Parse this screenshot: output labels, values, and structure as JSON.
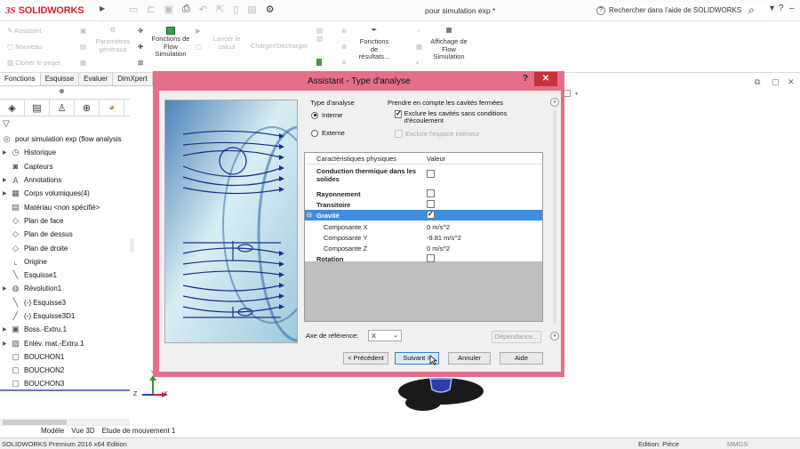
{
  "app": {
    "logo_ds": "3S",
    "logo_name": "SOLIDWORKS",
    "document_title": "pour simulation exp *",
    "help_search": "Rechercher dans l'aide de SOLIDWORKS"
  },
  "ribbon": {
    "left_small": [
      "Assistant",
      "Nouveau",
      "Cloner le projet"
    ],
    "parametres": "Paramètres généraux",
    "fonctions_flow": "Fonctions de Flow Simulation",
    "lancer": "Lancer le calcul",
    "charger": "Charger/Décharger",
    "fonctions_resultats": "Fonctions de résultats...",
    "affichage": "Affichage de Flow Simulation"
  },
  "panel_tabs": [
    "Fonctions",
    "Esquisse",
    "Evaluer",
    "DimXpert"
  ],
  "tree": {
    "root": "pour simulation exp  (flow analysis",
    "items": [
      {
        "label": "Historique",
        "expand": true,
        "icon": "history-icon"
      },
      {
        "label": "Capteurs",
        "expand": false,
        "icon": "sensor-icon"
      },
      {
        "label": "Annotations",
        "expand": true,
        "icon": "annotation-icon"
      },
      {
        "label": "Corps volumiques(4)",
        "expand": true,
        "icon": "solid-bodies-icon"
      },
      {
        "label": "Matériau <non spécifié>",
        "expand": false,
        "icon": "material-icon"
      },
      {
        "label": "Plan de face",
        "expand": false,
        "icon": "plane-icon"
      },
      {
        "label": "Plan de dessus",
        "expand": false,
        "icon": "plane-icon"
      },
      {
        "label": "Plan de droite",
        "expand": false,
        "icon": "plane-icon"
      },
      {
        "label": "Origine",
        "expand": false,
        "icon": "origin-icon"
      },
      {
        "label": "Esquisse1",
        "expand": false,
        "icon": "sketch-icon"
      },
      {
        "label": "Révolution1",
        "expand": true,
        "icon": "revolve-icon"
      },
      {
        "label": "(-) Esquisse3",
        "expand": false,
        "icon": "sketch-icon"
      },
      {
        "label": "(-) Esquisse3D1",
        "expand": false,
        "icon": "sketch3d-icon"
      },
      {
        "label": "Boss.-Extru.1",
        "expand": true,
        "icon": "extrude-icon"
      },
      {
        "label": "Enlév. mat.-Extru.1",
        "expand": true,
        "icon": "cut-icon"
      },
      {
        "label": "BOUCHON1",
        "expand": false,
        "icon": "lid-icon"
      },
      {
        "label": "BOUCHON2",
        "expand": false,
        "icon": "lid-icon"
      },
      {
        "label": "BOUCHON3",
        "expand": false,
        "icon": "lid-icon"
      }
    ]
  },
  "bottom_tabs": [
    "Modèle",
    "Vue 3D",
    "Etude de mouvement 1"
  ],
  "status": {
    "left": "SOLIDWORKS Premium 2016 x64 Edition",
    "mid": "Edition: Pièce",
    "right": "MMGS"
  },
  "dialog": {
    "title": "Assistant - Type d'analyse",
    "help": "?",
    "close": "✕",
    "analysis_type_label": "Type d'analyse",
    "radio_interne": "Interne",
    "radio_externe": "Externe",
    "cavities_label": "Prendre en compte les cavités fermées",
    "exclude_cavities": "Exclure les cavités sans conditions d'écoulement",
    "exclude_internal": "Exclure l'espace intérieur",
    "grid_header": {
      "col1": "Caractéristiques physiques",
      "col2": "Valeur"
    },
    "rows": [
      {
        "label": "Conduction thermique dans les solides",
        "checked": false
      },
      {
        "label": "Rayonnement",
        "checked": false
      },
      {
        "label": "Transitoire",
        "checked": false
      },
      {
        "label": "Gravité",
        "checked": true
      },
      {
        "label": "Composante X",
        "value": "0 m/s^2"
      },
      {
        "label": "Composante Y",
        "value": "-9.81 m/s^2"
      },
      {
        "label": "Composante Z",
        "value": "0 m/s^2"
      },
      {
        "label": "Rotation",
        "checked": false
      }
    ],
    "axis_label": "Axe de référence:",
    "axis_value": "X",
    "dependance": "Dépendance...",
    "btn_prev": "< Précédent",
    "btn_next": "Suivant >",
    "btn_cancel": "Annuler",
    "btn_help": "Aide"
  },
  "triad": {
    "x": "X",
    "y": "Y",
    "z": "Z"
  }
}
